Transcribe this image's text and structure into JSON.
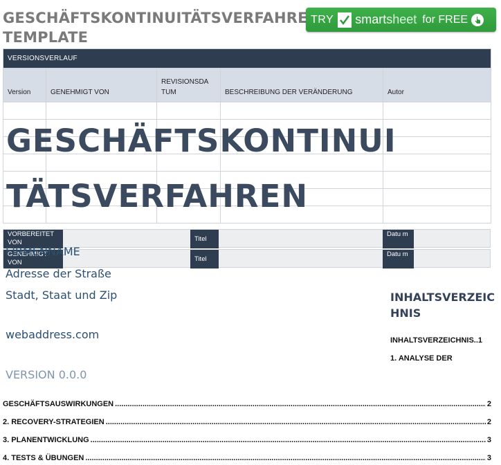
{
  "document": {
    "title": "GESCHÄFTSKONTINUITÄTSVERFAHREN TEMPLATE",
    "big_title": "GESCHÄFTSKONTINUI TÄTSVERFAHREN"
  },
  "cta": {
    "try": "TRY",
    "brand_a": "smart",
    "brand_b": "sheet",
    "free": "for FREE",
    "icons": [
      "check-icon",
      "pointer-icon"
    ],
    "color": "#3eb14a"
  },
  "version_table": {
    "section_title": "VERSIONSVERLAUF",
    "columns": [
      "Version",
      "GENEHMIGT VON",
      "REVISIONSDA TUM",
      "BESCHREIBUNG DER VERÄNDERUNG",
      "Autor"
    ],
    "header_color": "#2f3d51"
  },
  "prepared": {
    "prepared_by": "VORBEREITET VON",
    "approved_by": "GENEHMIGT VON",
    "title_label": "Titel",
    "date_label": "Datu m"
  },
  "company": {
    "name": "FIRMENNAME",
    "address": "Adresse der Straße",
    "city": "Stadt, Staat und Zip",
    "web": "webaddress.com",
    "version": "VERSION 0.0.0"
  },
  "toc": {
    "heading": "INHALTSVERZEIC HNIS",
    "side_entry_1": "INHALTSVERZEICHNIS..1",
    "side_entry_2": "1. ANALYSE DER",
    "entries": [
      {
        "label": "GESCHÄFTSAUSWIRKUNGEN",
        "page": "2"
      },
      {
        "label": "2. RECOVERY-STRATEGIEN",
        "page": "2"
      },
      {
        "label": "3. PLANENTWICKLUNG",
        "page": "3"
      },
      {
        "label": "4. TESTS & ÜBUNGEN",
        "page": "3"
      }
    ]
  }
}
